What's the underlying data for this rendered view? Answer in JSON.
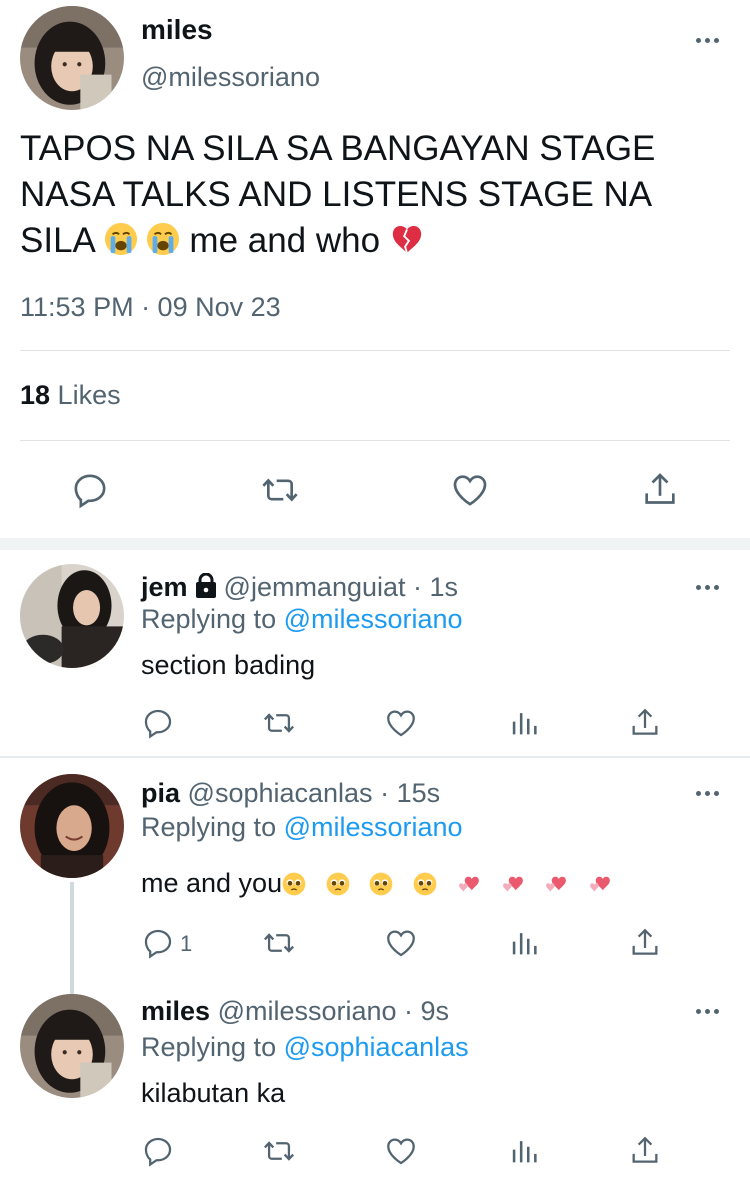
{
  "main_tweet": {
    "name": "miles",
    "handle": "@milessoriano",
    "text_part1": "TAPOS NA SILA SA BANGAYAN STAGE NASA TALKS AND LISTENS STAGE NA SILA",
    "text_part2": " me and who ",
    "emojis": [
      "loudly-crying-face",
      "loudly-crying-face",
      "broken-heart"
    ],
    "timestamp": "11:53 PM · 09 Nov 23",
    "likes_count": "18",
    "likes_label": " Likes"
  },
  "replies": [
    {
      "name": "jem",
      "protected": true,
      "handle": "@jemmanguiat",
      "dot": " · ",
      "time": "1s",
      "replying_label": "Replying to ",
      "replying_to": "@milessoriano",
      "text": "section bading",
      "reply_count": ""
    },
    {
      "name": "pia",
      "protected": false,
      "handle": "@sophiacanlas",
      "dot": " · ",
      "time": "15s",
      "replying_label": "Replying to ",
      "replying_to": "@milessoriano",
      "text": "me and you",
      "emojis": [
        "pleading-face",
        "pleading-face",
        "pleading-face",
        "pleading-face",
        "two-hearts",
        "two-hearts",
        "two-hearts",
        "two-hearts"
      ],
      "reply_count": "1"
    },
    {
      "name": "miles",
      "protected": false,
      "handle": "@milessoriano",
      "dot": " · ",
      "time": "9s",
      "replying_label": "Replying to ",
      "replying_to": "@sophiacanlas",
      "text": "kilabutan ka",
      "reply_count": ""
    }
  ],
  "icons": {
    "reply": "speech-bubble-icon",
    "retweet": "retweet-icon",
    "like": "heart-icon",
    "analytics": "bar-chart-icon",
    "share": "share-icon",
    "more": "more-dots-icon",
    "protected": "lock-icon"
  },
  "colors": {
    "text": "#0f1419",
    "secondary": "#536471",
    "link": "#1d9bf0",
    "separator": "#eff3f4"
  }
}
